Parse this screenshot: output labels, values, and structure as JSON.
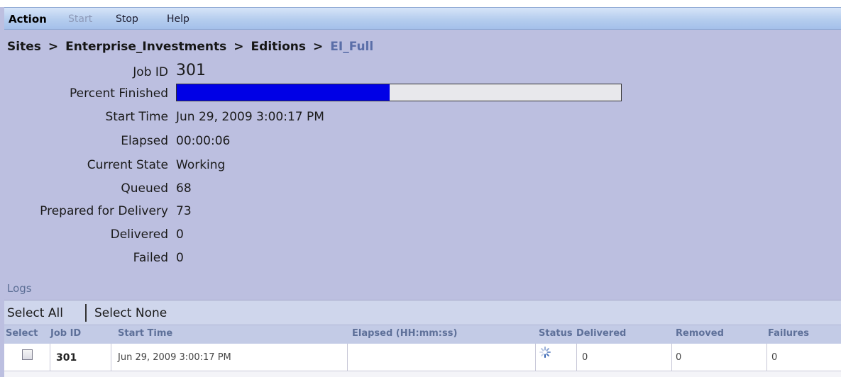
{
  "menu": {
    "action": "Action",
    "start": "Start",
    "stop": "Stop",
    "help": "Help"
  },
  "breadcrumb": {
    "sites": "Sites",
    "enterprise": "Enterprise_Investments",
    "editions": "Editions",
    "current": "EI_Full",
    "separator": ">"
  },
  "job": {
    "job_id_label": "Job ID",
    "job_id": "301",
    "percent_label": "Percent Finished",
    "percent_finished": 0.48,
    "start_time_label": "Start Time",
    "start_time": "Jun 29, 2009 3:00:17 PM",
    "elapsed_label": "Elapsed",
    "elapsed": "00:00:06",
    "state_label": "Current State",
    "state": "Working",
    "queued_label": "Queued",
    "queued": "68",
    "prepared_label": "Prepared for Delivery",
    "prepared": "73",
    "delivered_label": "Delivered",
    "delivered": "0",
    "failed_label": "Failed",
    "failed": "0"
  },
  "logs": {
    "title": "Logs",
    "select_all": "Select All",
    "select_none": "Select None",
    "columns": {
      "select": "Select",
      "job_id": "Job ID",
      "start_time": "Start Time",
      "elapsed": "Elapsed (HH:mm:ss)",
      "status": "Status",
      "delivered": "Delivered",
      "removed": "Removed",
      "failures": "Failures"
    },
    "rows": [
      {
        "job_id": "301",
        "start_time": "Jun 29, 2009 3:00:17 PM",
        "elapsed": "",
        "status_icon": "spinner-icon",
        "delivered": "0",
        "removed": "0",
        "failures": "0"
      }
    ]
  },
  "colors": {
    "background": "#bcbfe0",
    "progress_fill": "#0000e6",
    "breadcrumb_current": "#5a6ea8"
  }
}
